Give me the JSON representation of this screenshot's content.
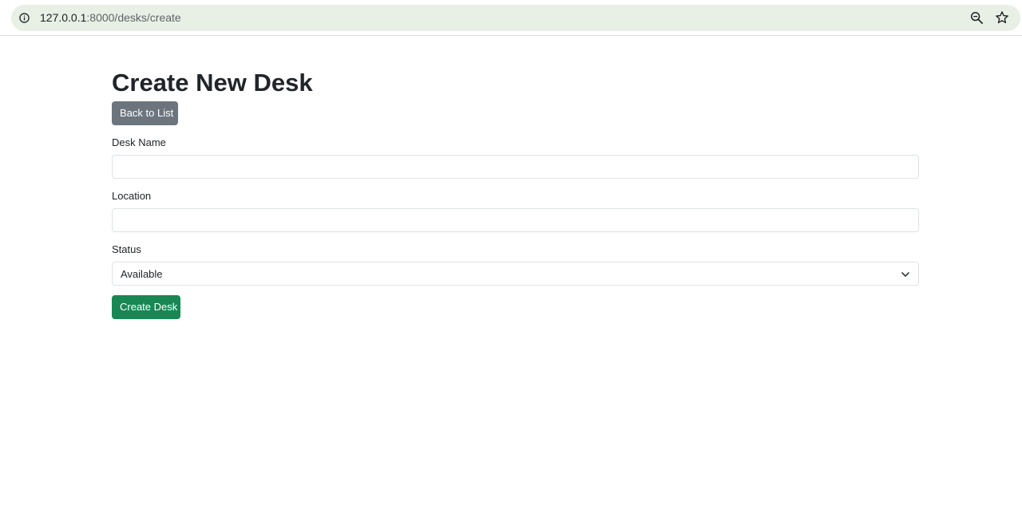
{
  "browser": {
    "url_host": "127.0.0.1",
    "url_path": ":8000/desks/create"
  },
  "page": {
    "title": "Create New Desk",
    "back_button_label": "Back to List",
    "submit_button_label": "Create Desk"
  },
  "form": {
    "desk_name": {
      "label": "Desk Name",
      "value": ""
    },
    "location": {
      "label": "Location",
      "value": ""
    },
    "status": {
      "label": "Status",
      "selected": "Available"
    }
  },
  "colors": {
    "secondary": "#6c757d",
    "success": "#198754",
    "omnibox": "#e8efe4"
  }
}
